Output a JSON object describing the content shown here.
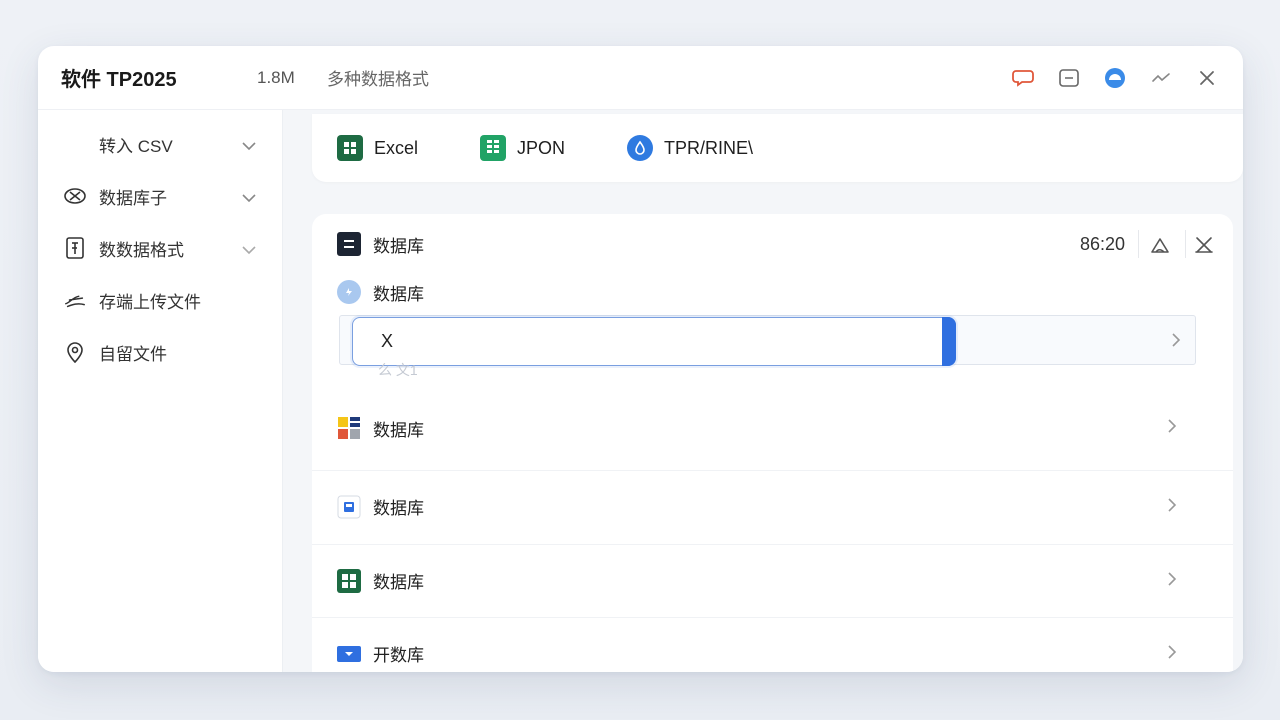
{
  "titlebar": {
    "app_title": "软件 TP2025",
    "size": "1.8M",
    "subtitle": "多种数据格式",
    "icons": [
      "chat-icon",
      "minimize-icon",
      "cloud-icon",
      "collapse-icon",
      "close-icon"
    ]
  },
  "sidebar": {
    "items": [
      {
        "label": "转入  CSV",
        "icon": "import-icon",
        "expandable": true
      },
      {
        "label": "数据库子",
        "icon": "eye-off-icon",
        "expandable": true
      },
      {
        "label": "数数据格式",
        "icon": "document-icon",
        "expandable": true
      },
      {
        "label": "存端上传文件",
        "icon": "upload-cloud-icon",
        "expandable": false
      },
      {
        "label": "自留文件",
        "icon": "location-pin-icon",
        "expandable": false
      }
    ]
  },
  "formats": [
    {
      "label": "Excel",
      "icon": "excel-icon",
      "color": "#1e6b43"
    },
    {
      "label": "JPON",
      "icon": "sheet-icon",
      "color": "#21a366"
    },
    {
      "label": "TPR/RINE\\",
      "icon": "drop-icon",
      "color": "#2f7ae0"
    }
  ],
  "panel": {
    "title": "数据库",
    "time": "86:20",
    "sub_title": "数据库",
    "input": {
      "value": "X",
      "ghost": "么 文1"
    },
    "rows": [
      {
        "label": "数据库",
        "icon": "grid-color-icon"
      },
      {
        "label": "数据库",
        "icon": "save-icon"
      },
      {
        "label": "数据库",
        "icon": "apps-icon"
      },
      {
        "label": "开数库",
        "icon": "dropdown-box-icon"
      }
    ]
  },
  "colors": {
    "accent": "#2f6fe0",
    "chat_icon": "#e0573a",
    "cloud_icon": "#3a8be8"
  }
}
